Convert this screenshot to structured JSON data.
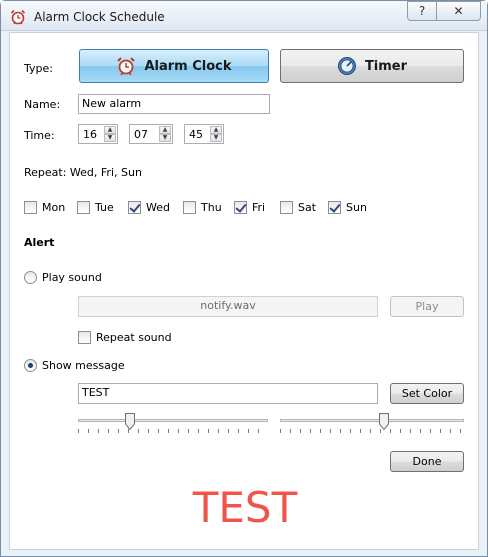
{
  "window": {
    "title": "Alarm Clock Schedule",
    "help_label": "?",
    "close_label": "✕"
  },
  "type": {
    "label": "Type:",
    "alarm_label": "Alarm Clock",
    "timer_label": "Timer",
    "selected": "Alarm Clock"
  },
  "name": {
    "label": "Name:",
    "value": "New alarm"
  },
  "time": {
    "label": "Time:",
    "hours": "16",
    "minutes": "07",
    "seconds": "45"
  },
  "repeat": {
    "summary": "Repeat: Wed, Fri, Sun",
    "days": [
      {
        "label": "Mon",
        "checked": false
      },
      {
        "label": "Tue",
        "checked": false
      },
      {
        "label": "Wed",
        "checked": true
      },
      {
        "label": "Thu",
        "checked": false
      },
      {
        "label": "Fri",
        "checked": true
      },
      {
        "label": "Sat",
        "checked": false
      },
      {
        "label": "Sun",
        "checked": true
      }
    ]
  },
  "alert": {
    "heading": "Alert",
    "play_sound_label": "Play sound",
    "play_sound_selected": false,
    "sound_file": "notify.wav",
    "play_button": "Play",
    "repeat_sound_label": "Repeat sound",
    "repeat_sound_checked": false,
    "show_message_label": "Show message",
    "show_message_selected": true,
    "message_value": "TEST",
    "set_color_button": "Set Color",
    "slider1_level": 0.26,
    "slider2_level": 0.57
  },
  "preview_text": "TEST",
  "done_button": "Done",
  "colors": {
    "preview": "#f0544a",
    "accent_active": "#86c9ef"
  }
}
